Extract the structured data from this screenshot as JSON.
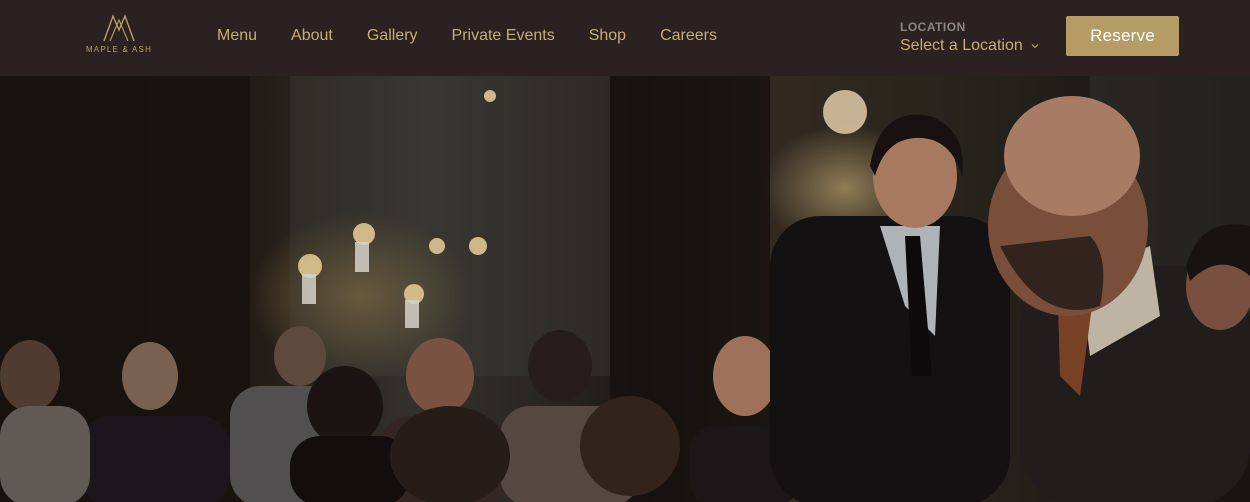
{
  "brand": {
    "name": "MAPLE & ASH",
    "logo_icon": "maple-ash-monogram"
  },
  "nav": {
    "items": [
      {
        "label": "Menu"
      },
      {
        "label": "About"
      },
      {
        "label": "Gallery"
      },
      {
        "label": "Private Events"
      },
      {
        "label": "Shop"
      },
      {
        "label": "Careers"
      }
    ]
  },
  "location": {
    "label": "LOCATION",
    "value": "Select a Location",
    "icon": "chevron-down-icon"
  },
  "reserve": {
    "label": "Reserve"
  },
  "hero": {
    "image": "restaurant-dining-room-photo"
  },
  "colors": {
    "header_bg": "#2a2120",
    "accent": "#c7ad72",
    "button_bg": "#b49c64",
    "label_gray": "#8c8784"
  }
}
